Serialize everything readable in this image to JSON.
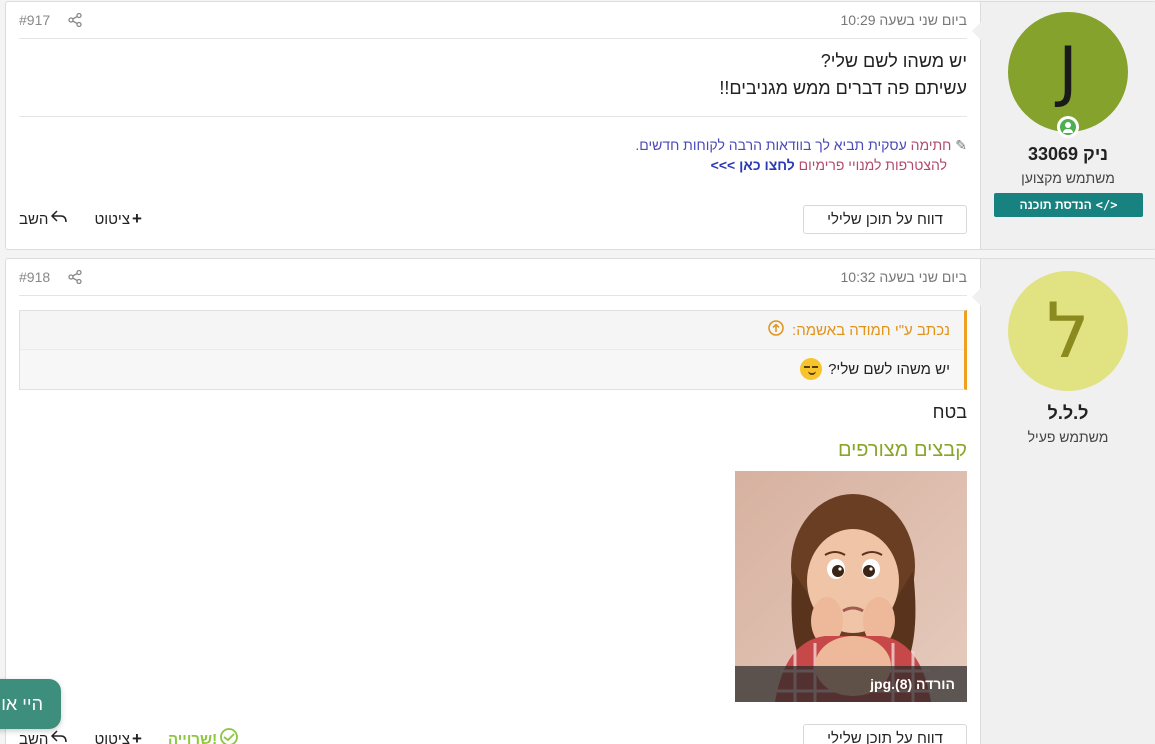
{
  "posts": [
    {
      "date": "ביום שני בשעה 10:29",
      "number": "#917",
      "body_lines": [
        "יש משהו לשם שלי?",
        "עשיתם פה דברים ממש מגניבים!!"
      ],
      "signature": {
        "label": "חתימה",
        "line1_text": "עסקית תביא לך בוודאות הרבה לקוחות חדשים.",
        "line2_text": "להצטרפות למנויי פרימיום",
        "line2_link": "לחצו כאן >>>"
      },
      "report_label": "דווח על תוכן שלילי",
      "quote_label": "ציטוט",
      "reply_label": "השב",
      "user": {
        "avatar_letter": "J",
        "avatar_color": "#84a22c",
        "name": "ניק 33069",
        "title": "משתמש מקצוען",
        "badge": "הנדסת תוכנה",
        "online": true
      }
    },
    {
      "date": "ביום שני בשעה 10:32",
      "number": "#918",
      "quote": {
        "header": "נכתב ע\"י חמודה באשמה:",
        "text": "יש משהו לשם שלי?"
      },
      "body_lines": [
        "בטח"
      ],
      "attachments_title": "קבצים מצורפים",
      "attachment": {
        "caption": "הורדה (8).jpg"
      },
      "report_label": "דווח על תוכן שלילי",
      "quote_label": "ציטוט",
      "reply_label": "השב",
      "thanks_label": "שרוייה!",
      "user": {
        "avatar_letter": "ל",
        "avatar_color": "#e1e282",
        "name": "ל.ל.ל",
        "title": "משתמש פעיל"
      }
    }
  ],
  "chat_widget": {
    "text": "היי או"
  }
}
